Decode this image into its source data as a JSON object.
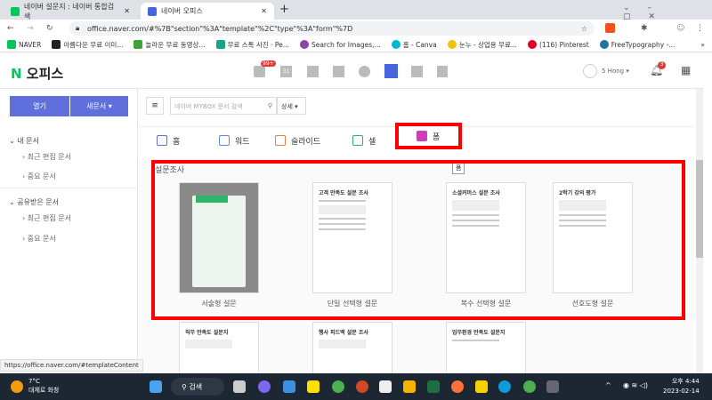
{
  "browser": {
    "tabs": [
      {
        "title": "네이버 설문지 : 네이버 통합검색",
        "active": false
      },
      {
        "title": "네이버 오피스",
        "active": true
      }
    ],
    "new_tab": "+",
    "url": "office.naver.com/#%7B\"section\"%3A\"template\"%2C\"type\"%3A\"form\"%7D",
    "bookmarks": [
      "NAVER",
      "아름다운 무료 이미...",
      "놀라운 무료 동영상...",
      "무료 스톡 사진 · Pe...",
      "Search for Images,...",
      "홈 - Canva",
      "눈누 - 상업용 무료...",
      "(116) Pinterest",
      "FreeTypography -..."
    ],
    "bookmarks_more": "»",
    "status_url": "https://office.naver.com/#templateContent"
  },
  "app": {
    "logo_n": "N",
    "logo_text": "오피스",
    "mail_badge": "99+",
    "calendar_day": "31",
    "user": "5 Hong ▾",
    "notif_badge": "3"
  },
  "sidebar": {
    "open_label": "열기",
    "new_label": "새문서 ▾",
    "sections": [
      {
        "title": "내 문서",
        "items": [
          "최근 편집 문서",
          "중요 문서"
        ]
      },
      {
        "title": "공유받은 문서",
        "items": [
          "최근 편집 문서",
          "중요 문서"
        ]
      }
    ]
  },
  "toolbar": {
    "search_placeholder": "네이버 MYBOX 문서 검색",
    "detail": "상세 ▾"
  },
  "type_tabs": [
    {
      "label": "홈",
      "color": "#5f6fdc"
    },
    {
      "label": "워드",
      "color": "#5b8def"
    },
    {
      "label": "슬라이드",
      "color": "#f07b3f"
    },
    {
      "label": "셀",
      "color": "#2fb56a"
    },
    {
      "label": "폼",
      "color": "#c940b8",
      "active": true
    }
  ],
  "templates": {
    "section_title": "설문조사",
    "tooltip": "폼",
    "cards": [
      {
        "title": "",
        "label": "서술형 설문"
      },
      {
        "title": "고객 만족도 설문 조사",
        "label": "단일 선택형 설문"
      },
      {
        "title": "소셜커머스 설문 조사",
        "label": "복수 선택형 설문"
      },
      {
        "title": "2학기 강의 평가",
        "label": "선호도형 설문"
      }
    ],
    "next_row": [
      "직무 만족도 설문지",
      "행사 피드백 설문 조사",
      "업무환경 만족도 설문지"
    ]
  },
  "taskbar": {
    "temp": "7°C",
    "weather": "대체로 화창",
    "search": "검색",
    "time": "오후 4:44",
    "date": "2023-02-14"
  },
  "colors": {
    "accent": "#5f6fdc",
    "highlight": "#ff0000",
    "form": "#c940b8"
  }
}
